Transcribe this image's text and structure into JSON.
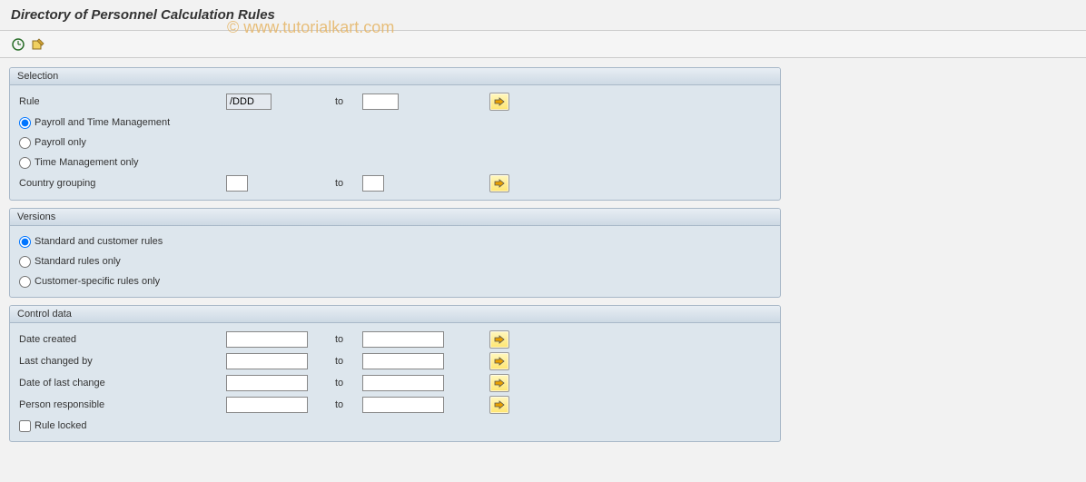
{
  "title": "Directory of Personnel Calculation Rules",
  "watermark": "© www.tutorialkart.com",
  "groups": {
    "selection": {
      "header": "Selection",
      "rule_label": "Rule",
      "rule_value": "/DDD",
      "to_label": "to",
      "radio_payroll_time": "Payroll and Time Management",
      "radio_payroll_only": "Payroll only",
      "radio_time_only": "Time Management only",
      "country_grouping_label": "Country grouping"
    },
    "versions": {
      "header": "Versions",
      "radio_standard_customer": "Standard and customer rules",
      "radio_standard_only": "Standard rules only",
      "radio_customer_only": "Customer-specific rules only"
    },
    "control_data": {
      "header": "Control data",
      "date_created_label": "Date created",
      "last_changed_by_label": "Last changed by",
      "date_last_change_label": "Date of last change",
      "person_responsible_label": "Person responsible",
      "rule_locked_label": "Rule locked",
      "to_label": "to"
    }
  }
}
